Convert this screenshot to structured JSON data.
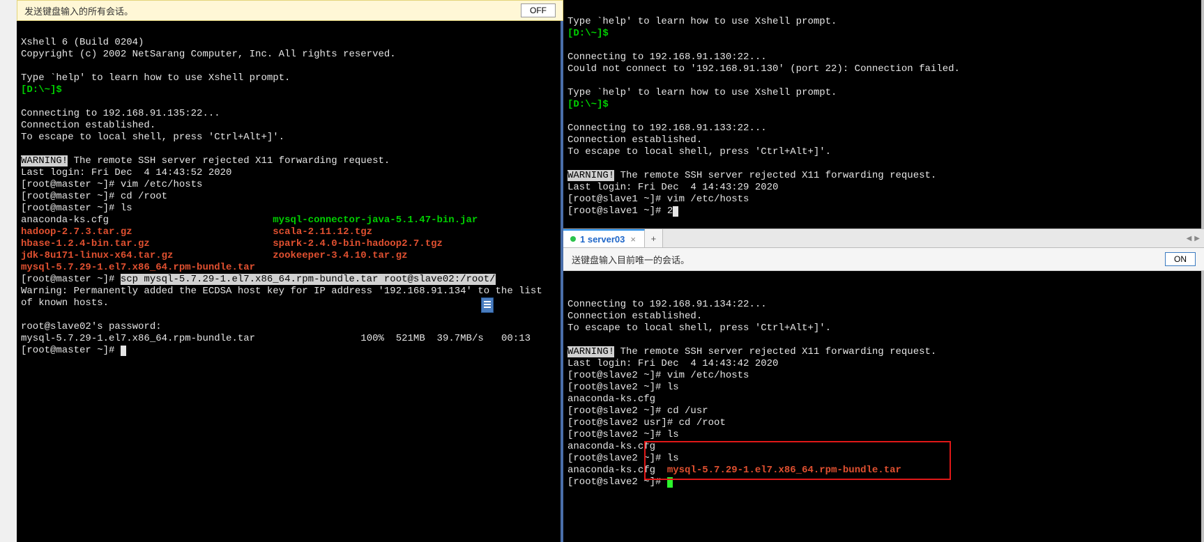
{
  "left": {
    "banner_text": "发送键盘输入的所有会话。",
    "banner_btn": "OFF",
    "lines": {
      "title": "Xshell 6 (Build 0204)",
      "copyright": "Copyright (c) 2002 NetSarang Computer, Inc. All rights reserved.",
      "help": "Type `help' to learn how to use Xshell prompt.",
      "prompt1": "[D:\\~]$",
      "connecting": "Connecting to 192.168.91.135:22...",
      "connest": "Connection established.",
      "escape": "To escape to local shell, press 'Ctrl+Alt+]'.",
      "warn_label": "WARNING!",
      "warn_rest": " The remote SSH server rejected X11 forwarding request.",
      "lastlogin": "Last login: Fri Dec  4 14:43:52 2020",
      "p_master": "[root@master ~]# ",
      "cmd_vim": "vim /etc/hosts",
      "cmd_cd": "cd /root",
      "cmd_ls": "ls",
      "files_col1": [
        "anaconda-ks.cfg",
        "hadoop-2.7.3.tar.gz",
        "hbase-1.2.4-bin.tar.gz",
        "jdk-8u171-linux-x64.tar.gz",
        "mysql-5.7.29-1.el7.x86_64.rpm-bundle.tar"
      ],
      "files_col2": [
        "mysql-connector-java-5.1.47-bin.jar",
        "scala-2.11.12.tgz",
        "spark-2.4.0-bin-hadoop2.7.tgz",
        "zookeeper-3.4.10.tar.gz"
      ],
      "scp_cmd": "scp mysql-5.7.29-1.el7.x86_64.rpm-bundle.tar root@slave02:/root/",
      "warn_perm": "Warning: Permanently added the ECDSA host key for IP address '192.168.91.134' to the list of known hosts.",
      "pwd": "root@slave02's password:",
      "xfer": "mysql-5.7.29-1.el7.x86_64.rpm-bundle.tar",
      "xfer_pct": "100%",
      "xfer_mb": "521MB",
      "xfer_rate": "39.7MB/s",
      "xfer_eta": "00:13"
    }
  },
  "right_upper": {
    "banner_text": "送键盘输入目前唯一的会话。",
    "help": "Type `help' to learn how to use Xshell prompt.",
    "prompt1": "[D:\\~]$",
    "conn130": "Connecting to 192.168.91.130:22...",
    "fail130": "Could not connect to '192.168.91.130' (port 22): Connection failed.",
    "conn133": "Connecting to 192.168.91.133:22...",
    "connest": "Connection established.",
    "escape": "To escape to local shell, press 'Ctrl+Alt+]'.",
    "warn_label": "WARNING!",
    "warn_rest": " The remote SSH server rejected X11 forwarding request.",
    "lastlogin": "Last login: Fri Dec  4 14:43:29 2020",
    "p_slave1": "[root@slave1 ~]# ",
    "cmd_vim": "vim /etc/hosts",
    "typed2": "2"
  },
  "tabbar": {
    "tab_label": "1 server03"
  },
  "msgbar": {
    "text": "送键盘输入目前唯一的会话。",
    "btn": "ON"
  },
  "right_lower": {
    "conn134": "Connecting to 192.168.91.134:22...",
    "connest": "Connection established.",
    "escape": "To escape to local shell, press 'Ctrl+Alt+]'.",
    "warn_label": "WARNING!",
    "warn_rest": " The remote SSH server rejected X11 forwarding request.",
    "lastlogin": "Last login: Fri Dec  4 14:43:42 2020",
    "p_slave2": "[root@slave2 ~]# ",
    "p_slave2usr": "[root@slave2 usr]# ",
    "cmd_vim": "vim /etc/hosts",
    "cmd_ls": "ls",
    "cmd_cdusr": "cd /usr",
    "cmd_cdroot": "cd /root",
    "anaconda": "anaconda-ks.cfg",
    "mysql_file": "mysql-5.7.29-1.el7.x86_64.rpm-bundle.tar"
  }
}
